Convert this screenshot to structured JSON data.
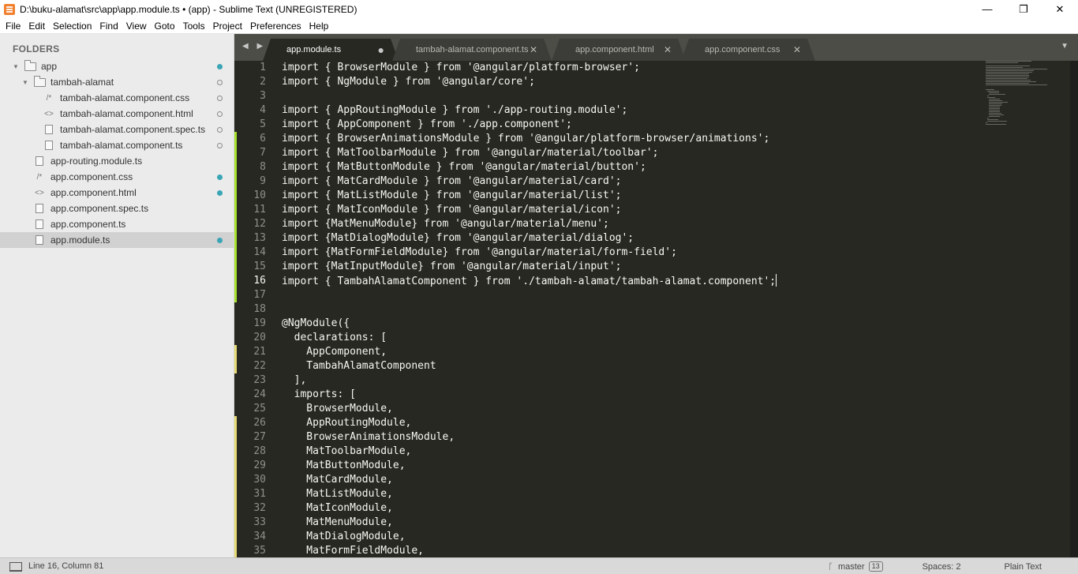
{
  "window": {
    "title": "D:\\buku-alamat\\src\\app\\app.module.ts • (app) - Sublime Text (UNREGISTERED)",
    "minimize": "—",
    "maximize": "❐",
    "close": "✕"
  },
  "menu": [
    "File",
    "Edit",
    "Selection",
    "Find",
    "View",
    "Goto",
    "Tools",
    "Project",
    "Preferences",
    "Help"
  ],
  "sidebar": {
    "title": "FOLDERS",
    "items": [
      {
        "label": "app",
        "icon": "folder-open-icon"
      },
      {
        "label": "tambah-alamat",
        "icon": "folder-open-icon"
      },
      {
        "label": "tambah-alamat.component.css",
        "icon": "css-file-icon",
        "glyph": "/*"
      },
      {
        "label": "tambah-alamat.component.html",
        "icon": "html-file-icon",
        "glyph": "<>"
      },
      {
        "label": "tambah-alamat.component.spec.ts",
        "icon": "file-icon"
      },
      {
        "label": "tambah-alamat.component.ts",
        "icon": "file-icon"
      },
      {
        "label": "app-routing.module.ts",
        "icon": "file-icon"
      },
      {
        "label": "app.component.css",
        "icon": "css-file-icon",
        "glyph": "/*"
      },
      {
        "label": "app.component.html",
        "icon": "html-file-icon",
        "glyph": "<>"
      },
      {
        "label": "app.component.spec.ts",
        "icon": "file-icon"
      },
      {
        "label": "app.component.ts",
        "icon": "file-icon"
      },
      {
        "label": "app.module.ts",
        "icon": "file-icon"
      }
    ]
  },
  "tabs": {
    "nav": "◀ ▶",
    "menu": "▼",
    "items": [
      {
        "label": "app.module.ts",
        "close": "●",
        "active": true
      },
      {
        "label": "tambah-alamat.component.ts",
        "close": "✕",
        "active": false
      },
      {
        "label": "app.component.html",
        "close": "✕",
        "active": false
      },
      {
        "label": "app.component.css",
        "close": "✕",
        "active": false
      }
    ]
  },
  "editor": {
    "line_numbers": [
      "1",
      "2",
      "3",
      "4",
      "5",
      "6",
      "7",
      "8",
      "9",
      "10",
      "11",
      "12",
      "13",
      "14",
      "15",
      "16",
      "17",
      "18",
      "19",
      "20",
      "21",
      "22",
      "23",
      "24",
      "25",
      "26",
      "27",
      "28",
      "29",
      "30",
      "31",
      "32",
      "33",
      "34",
      "35"
    ],
    "lines": [
      "import { BrowserModule } from '@angular/platform-browser';",
      "import { NgModule } from '@angular/core';",
      "",
      "import { AppRoutingModule } from './app-routing.module';",
      "import { AppComponent } from './app.component';",
      "import { BrowserAnimationsModule } from '@angular/platform-browser/animations';",
      "import { MatToolbarModule } from '@angular/material/toolbar';",
      "import { MatButtonModule } from '@angular/material/button';",
      "import { MatCardModule } from '@angular/material/card';",
      "import { MatListModule } from '@angular/material/list';",
      "import { MatIconModule } from '@angular/material/icon';",
      "import {MatMenuModule} from '@angular/material/menu';",
      "import {MatDialogModule} from '@angular/material/dialog';",
      "import {MatFormFieldModule} from '@angular/material/form-field';",
      "import {MatInputModule} from '@angular/material/input';",
      "import { TambahAlamatComponent } from './tambah-alamat/tambah-alamat.component';",
      "",
      "",
      "@NgModule({",
      "  declarations: [",
      "    AppComponent,",
      "    TambahAlamatComponent",
      "  ],",
      "  imports: [",
      "    BrowserModule,",
      "    AppRoutingModule,",
      "    BrowserAnimationsModule,",
      "    MatToolbarModule,",
      "    MatButtonModule,",
      "    MatCardModule,",
      "    MatListModule,",
      "    MatIconModule,",
      "    MatMenuModule,",
      "    MatDialogModule,",
      "    MatFormFieldModule,"
    ]
  },
  "status": {
    "position": "Line 16, Column 81",
    "branch": "master",
    "branch_count": "13",
    "indent": "Spaces: 2",
    "syntax": "Plain Text"
  },
  "colors": {
    "keyword": "#f92672",
    "string": "#e6db74",
    "decorator_name": "#a6e22e",
    "plain": "#f8f8f2",
    "dot_modified": "#3aa5b6"
  }
}
